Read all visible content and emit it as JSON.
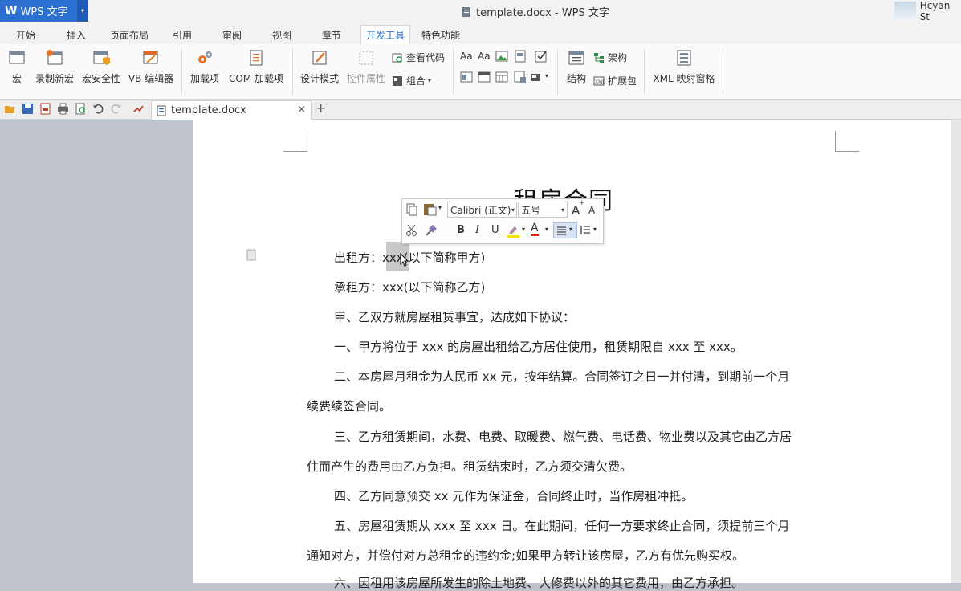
{
  "app": {
    "logo": "W",
    "name": "WPS 文字",
    "menu_arrow": "▾"
  },
  "window_title": "template.docx - WPS 文字",
  "user": {
    "name": "Hcyan St"
  },
  "tabs": [
    {
      "label": "开始"
    },
    {
      "label": "插入"
    },
    {
      "label": "页面布局"
    },
    {
      "label": "引用"
    },
    {
      "label": "审阅"
    },
    {
      "label": "视图"
    },
    {
      "label": "章节"
    },
    {
      "label": "开发工具",
      "active": true
    },
    {
      "label": "特色功能"
    }
  ],
  "ribbon": {
    "macro": "宏",
    "record_macro": "录制新宏",
    "macro_security": "宏安全性",
    "vb_editor": "VB 编辑器",
    "addins": "加载项",
    "com_addins": "COM 加载项",
    "design_mode": "设计模式",
    "control_props": "控件属性",
    "view_code": "查看代码",
    "group": "组合",
    "structure": "结构",
    "schema": "架构",
    "expansion_pack": "扩展包",
    "xml_mapping": "XML 映射窗格",
    "aa1": "Aa",
    "aa2": "Aa"
  },
  "doc_tab": {
    "filename": "template.docx",
    "close": "×",
    "add": "+"
  },
  "document": {
    "title": "租房合同",
    "paragraphs": [
      "出租方：xxx(以下简称甲方)",
      "承租方：xxx(以下简称乙方)",
      "甲、乙双方就房屋租赁事宜，达成如下协议：",
      "一、甲方将位于 xxx 的房屋出租给乙方居住使用，租赁期限自 xxx 至 xxx。",
      "二、本房屋月租金为人民币 xx 元，按年结算。合同签订之日一并付清，到期前一个月",
      "续费续签合同。",
      "三、乙方租赁期间，水费、电费、取暖费、燃气费、电话费、物业费以及其它由乙方居",
      "住而产生的费用由乙方负担。租赁结束时，乙方须交清欠费。",
      "四、乙方同意预交 xx 元作为保证金，合同终止时，当作房租冲抵。",
      "五、房屋租赁期从 xxx 至 xxx 日。在此期间，任何一方要求终止合同，须提前三个月",
      "通知对方，并偿付对方总租金的违约金;如果甲方转让该房屋，乙方有优先购买权。",
      "六、因租用该房屋所发生的除土地费、大修费以外的其它费用，由乙方承担。"
    ]
  },
  "mini_toolbar": {
    "font_name": "Calibri (正文)",
    "font_size": "五号",
    "grow": "A",
    "shrink": "A",
    "bold": "B",
    "italic": "I",
    "underline": "U",
    "font_color": "A"
  },
  "colors": {
    "accent": "#2b6fd1",
    "highlight": "#c8c8c8"
  }
}
